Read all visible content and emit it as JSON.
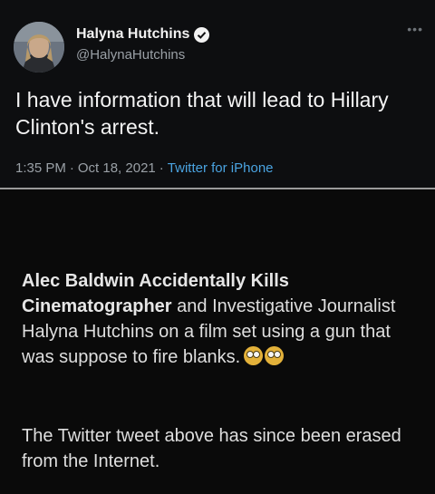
{
  "tweet": {
    "author_name": "Halyna Hutchins",
    "handle": "@HalynaHutchins",
    "text": "I have information that will lead to Hillary Clinton's arrest.",
    "time": "1:35 PM",
    "date": "Oct 18, 2021",
    "client": "Twitter for iPhone",
    "verified_icon": "verified-badge-icon",
    "more_icon": "more-options-icon",
    "link_color": "#4aa3e0"
  },
  "caption": {
    "headline_bold": "Alec Baldwin Accidentally Kills Cinematographer",
    "headline_rest": " and Investigative Journalist Halyna Hutchins on a film set using a gun that was suppose to fire blanks.",
    "emojis": [
      "rolling-eyes-emoji",
      "rolling-eyes-emoji"
    ],
    "footer": "The Twitter tweet above has since been erased from the Internet."
  }
}
